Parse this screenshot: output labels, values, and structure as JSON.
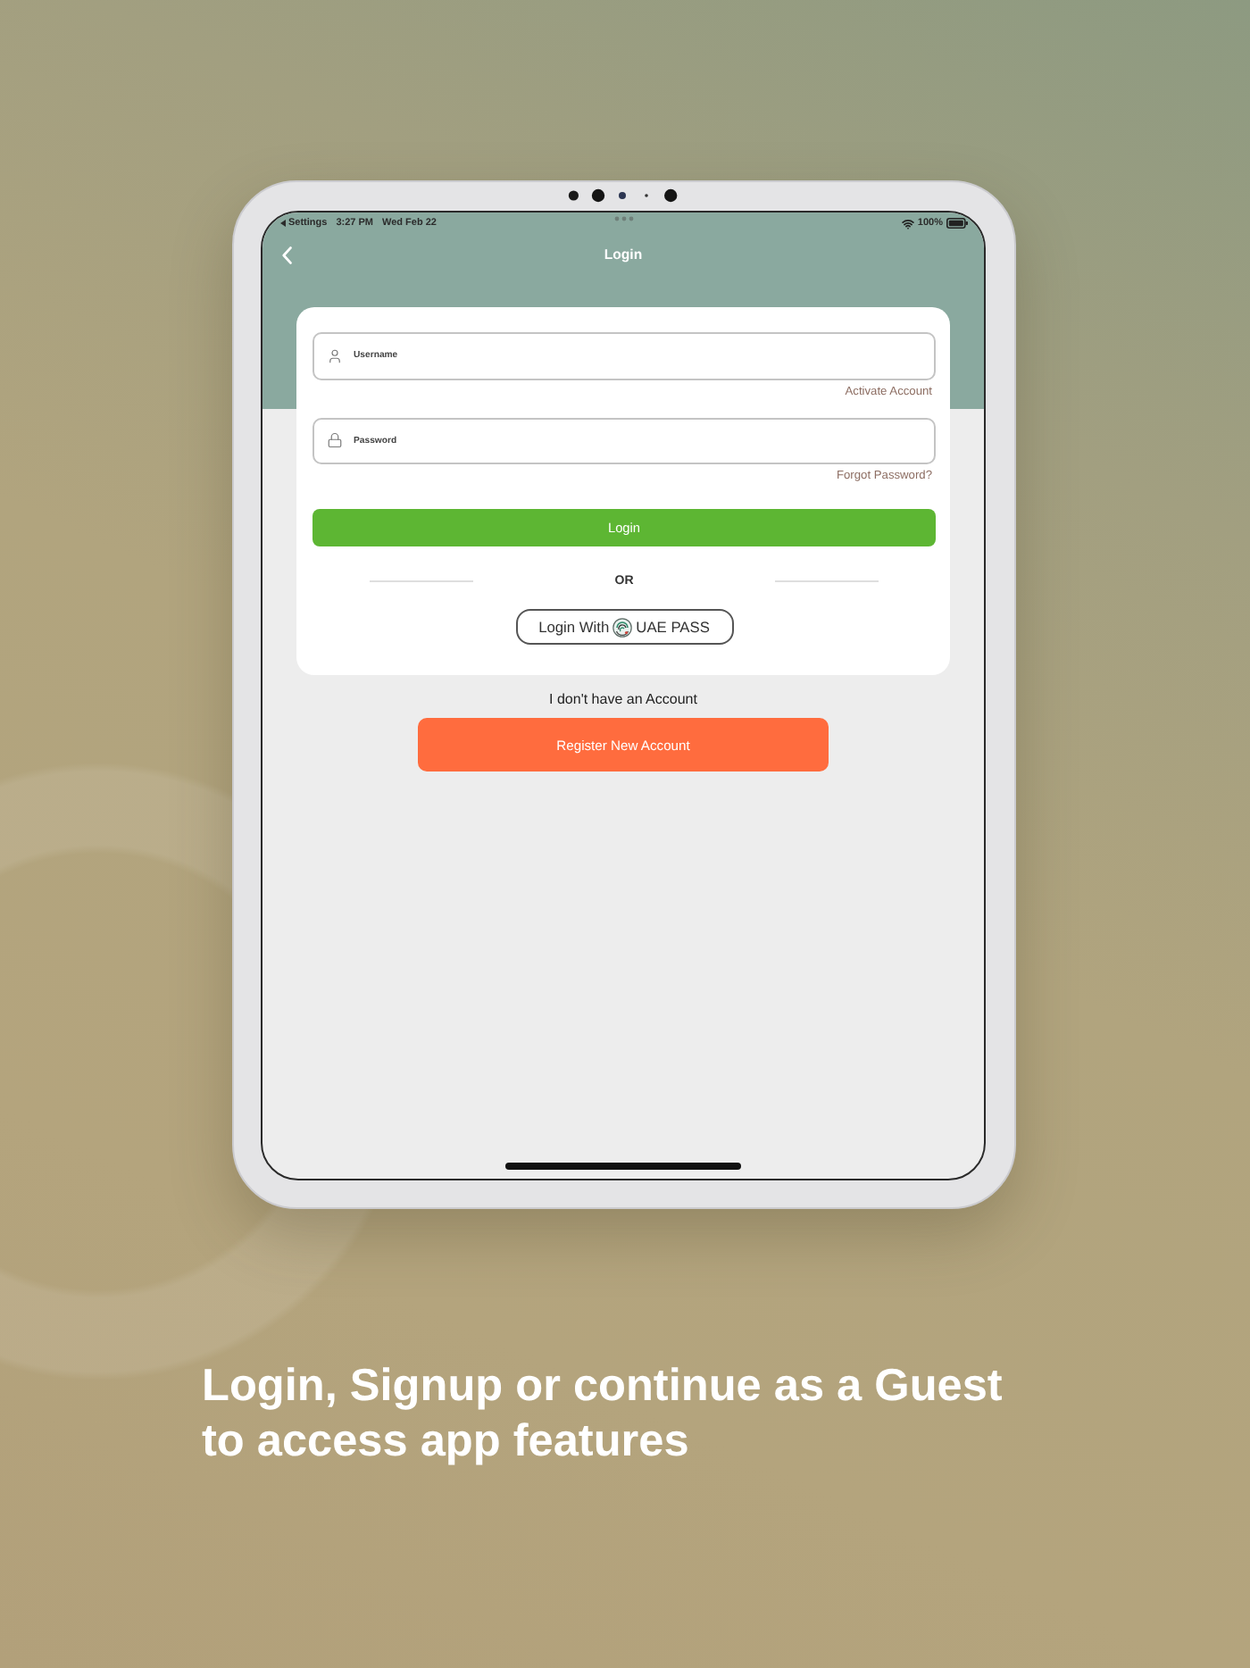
{
  "device": {
    "status_bar": {
      "back_app": "Settings",
      "time": "3:27 PM",
      "date": "Wed Feb 22",
      "battery_percent": "100%"
    },
    "nav": {
      "title": "Login"
    },
    "form": {
      "fields": [
        {
          "kind": "username",
          "placeholder": "Username",
          "link": "Activate Account"
        },
        {
          "kind": "password",
          "placeholder": "Password",
          "link": "Forgot Password?"
        }
      ],
      "login_button": "Login",
      "divider": "OR",
      "uae_pass_button": {
        "prefix": "Login With",
        "brand": "UAE PASS"
      }
    },
    "register_prompt": "I don't have an Account",
    "register_button": "Register New Account"
  },
  "caption": "Login, Signup or continue as a Guest to access app features"
}
